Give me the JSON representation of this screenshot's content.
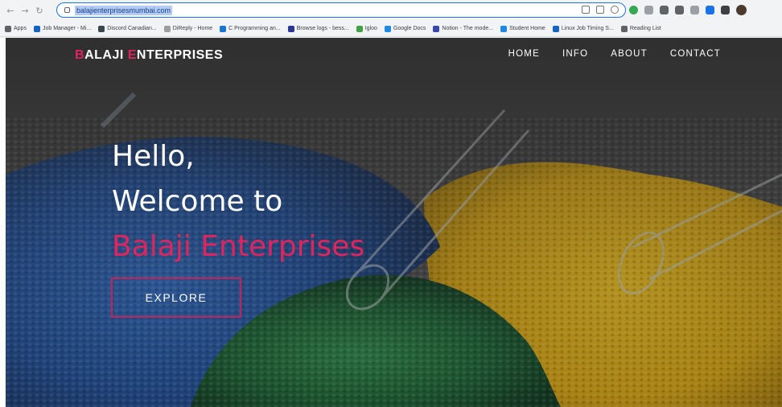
{
  "browser": {
    "url": "balajienterprisesmumbai.com",
    "bookmarks": [
      {
        "label": "Apps",
        "color": "#5f6368"
      },
      {
        "label": "Job Manager - Mi...",
        "color": "#1565c0"
      },
      {
        "label": "Discord Canadian...",
        "color": "#37474f"
      },
      {
        "label": "DiReply - Home",
        "color": "#9e9e9e"
      },
      {
        "label": "C Programming an...",
        "color": "#1976d2"
      },
      {
        "label": "Browse logs - bess...",
        "color": "#283593"
      },
      {
        "label": "Igloo",
        "color": "#43a047"
      },
      {
        "label": "Google Docs",
        "color": "#1e88e5"
      },
      {
        "label": "Notion - The mode...",
        "color": "#3949ab"
      },
      {
        "label": "Student Home",
        "color": "#1e88e5"
      },
      {
        "label": "Linux Job Timing S...",
        "color": "#1565c0"
      },
      {
        "label": "Reading List",
        "color": "#5f6368"
      }
    ],
    "extension_colors": [
      "#34a853",
      "#9aa0a6",
      "#5f6368",
      "#5f6368",
      "#9aa0a6",
      "#1a73e8",
      "#3c4043"
    ]
  },
  "site": {
    "brand_first_letter": "B",
    "brand_first_rest": "ALAJI ",
    "brand_second_letter": "E",
    "brand_second_rest": "NTERPRISES",
    "nav": [
      "HOME",
      "INFO",
      "ABOUT",
      "CONTACT"
    ],
    "hero_line1": "Hello,",
    "hero_line2": "Welcome to",
    "hero_line3": "Balaji Enterprises",
    "cta_label": "EXPLORE",
    "accent_color": "#e0245e"
  }
}
